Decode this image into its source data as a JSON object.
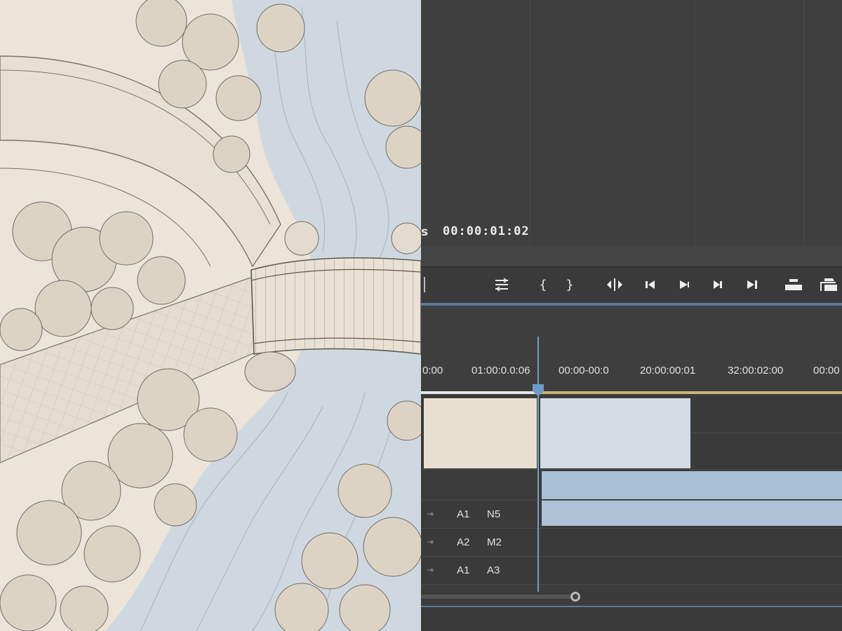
{
  "artwork": {
    "subject": "hand-drawn aerial view of a curved path, an arched footbridge over a river and surrounding trees",
    "colors": {
      "paper": "#ece4d8",
      "water": "#cfd8e0",
      "ink": "#6e6a64",
      "tree": "#ddd3c5"
    }
  },
  "viewer": {
    "timecode_prefix": "s",
    "timecode": "00:00:01:02"
  },
  "transport": {
    "buttons": [
      {
        "id": "settings",
        "icon": "settings-lines-icon"
      },
      {
        "id": "mark-in",
        "icon": "mark-in-icon",
        "label": "{"
      },
      {
        "id": "mark-out",
        "icon": "mark-out-icon",
        "label": "}"
      },
      {
        "id": "split",
        "icon": "split-icon"
      },
      {
        "id": "step-back",
        "icon": "step-back-icon"
      },
      {
        "id": "play",
        "icon": "play-icon"
      },
      {
        "id": "step-forward",
        "icon": "step-forward-icon"
      },
      {
        "id": "go-to-end",
        "icon": "go-to-end-icon"
      },
      {
        "id": "lift",
        "icon": "lift-icon"
      },
      {
        "id": "extract",
        "icon": "extract-icon"
      }
    ]
  },
  "ruler": {
    "ticks": [
      "0:00",
      "01:00:0.0:06",
      "00:00-00:0",
      "20:00:00:01",
      "32:00:02:00",
      "00:00"
    ]
  },
  "tracks": [
    {
      "name": "A1",
      "source": "N5"
    },
    {
      "name": "A2",
      "source": "M2"
    },
    {
      "name": "A1",
      "source": "A3"
    }
  ],
  "clips": {
    "colors": {
      "beige": "#e9dfd1",
      "light_blue": "#d3dbe5",
      "mid_blue": "#a9bfd6",
      "accent_blue": "#6f9cc9"
    }
  }
}
